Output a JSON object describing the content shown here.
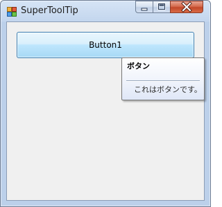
{
  "window": {
    "title": "SuperToolTip",
    "icons": {
      "app": "app-icon",
      "minimize": "minimize-icon",
      "maximize": "maximize-icon",
      "close": "close-icon"
    }
  },
  "form": {
    "button1_label": "Button1"
  },
  "tooltip": {
    "title": "ボタン",
    "body": "これはボタンです。"
  },
  "colors": {
    "close_button": "#c94f2e",
    "button_border": "#3c7fb1",
    "client_background": "#f0f0f0"
  }
}
